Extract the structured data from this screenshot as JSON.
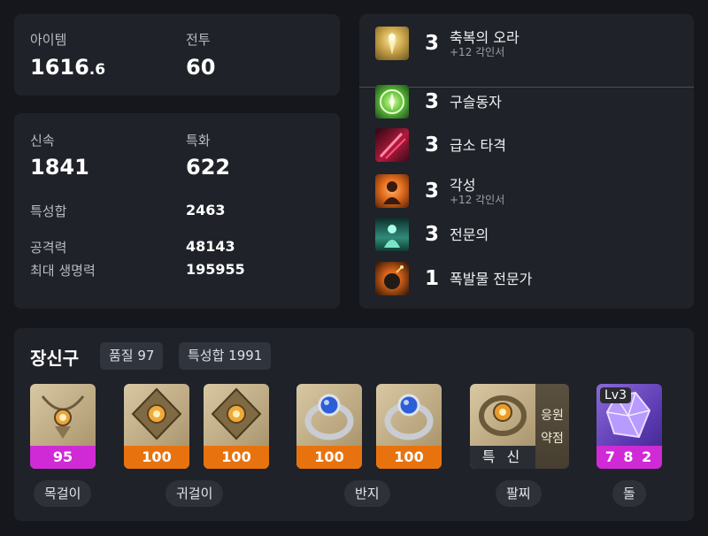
{
  "summary": {
    "item_level_label": "아이템",
    "item_level_int": "1616",
    "item_level_frac": ".6",
    "combat_label": "전투",
    "combat_value": "60"
  },
  "stats": {
    "swift_label": "신속",
    "swift_value": "1841",
    "spec_label": "특화",
    "spec_value": "622",
    "total_label": "특성합",
    "total_value": "2463",
    "attack_label": "공격력",
    "attack_value": "48143",
    "hp_label": "최대 생명력",
    "hp_value": "195955"
  },
  "engravings": [
    {
      "level": "3",
      "name": "축복의 오라",
      "sub": "+12 각인서",
      "icon": "aura-icon",
      "color": "#c9a54a"
    },
    {
      "level": "3",
      "name": "구슬동자",
      "sub": "",
      "icon": "orb-icon",
      "color": "#5fbf3a"
    },
    {
      "level": "3",
      "name": "급소 타격",
      "sub": "",
      "icon": "strike-icon",
      "color": "#b11a3c"
    },
    {
      "level": "3",
      "name": "각성",
      "sub": "+12 각인서",
      "icon": "awaken-icon",
      "color": "#e06a1c"
    },
    {
      "level": "3",
      "name": "전문의",
      "sub": "",
      "icon": "expert-icon",
      "color": "#2f8c7a"
    },
    {
      "level": "1",
      "name": "폭발물 전문가",
      "sub": "",
      "icon": "bomb-icon",
      "color": "#d4611a"
    }
  ],
  "accessories": {
    "title": "장신구",
    "quality_chip": "품질 97",
    "total_chip": "특성합 1991",
    "items": [
      {
        "value": "95",
        "bar": "magenta",
        "name": "necklace"
      },
      {
        "value": "100",
        "bar": "orange",
        "name": "earring-1"
      },
      {
        "value": "100",
        "bar": "orange",
        "name": "earring-2"
      },
      {
        "value": "100",
        "bar": "orange",
        "name": "ring-1"
      },
      {
        "value": "100",
        "bar": "orange",
        "name": "ring-2"
      },
      {
        "value": "특 신",
        "bar": "dark",
        "name": "bracelet"
      },
      {
        "value": "7 8 2",
        "bar": "magenta",
        "name": "stone"
      }
    ],
    "bracelet_side_1": "응원",
    "bracelet_side_2": "약점",
    "stone_level": "Lv3",
    "labels": {
      "necklace": "목걸이",
      "earring": "귀걸이",
      "ring": "반지",
      "bracelet": "팔찌",
      "stone": "돌"
    }
  },
  "colors": {
    "orange": "#e8730e",
    "magenta": "#d02ad6",
    "panel": "#1f2228",
    "background": "#15171c"
  }
}
